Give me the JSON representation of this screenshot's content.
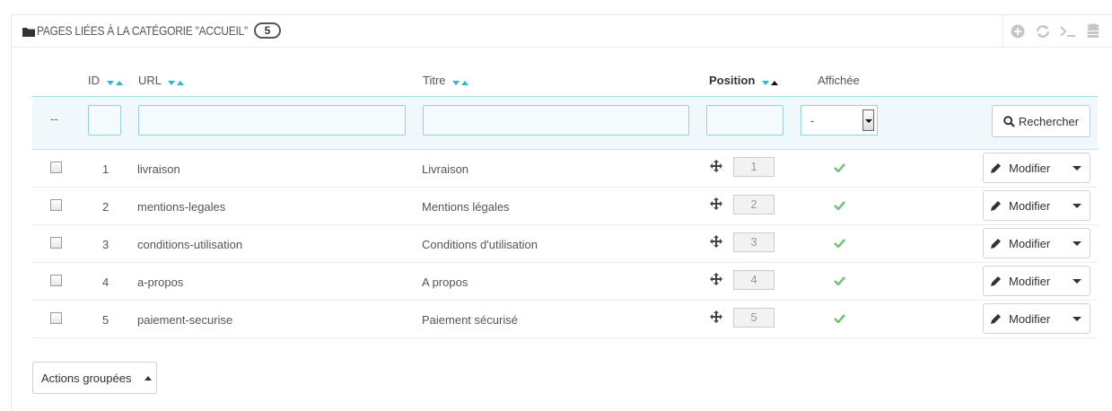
{
  "panel": {
    "title": "Pages liées à la catégorie \"Accueil\"",
    "count": "5",
    "toolbar": [
      "add-icon",
      "refresh-icon",
      "terminal-icon",
      "database-icon"
    ]
  },
  "table": {
    "headers": {
      "id": "ID",
      "url": "URL",
      "title": "Titre",
      "position": "Position",
      "displayed": "Affichée"
    },
    "filter": {
      "dash": "--",
      "displayed_value": "-",
      "search_label": "Rechercher"
    },
    "rows": [
      {
        "id": "1",
        "url": "livraison",
        "title": "Livraison",
        "position": "1",
        "displayed": true,
        "action": "Modifier"
      },
      {
        "id": "2",
        "url": "mentions-legales",
        "title": "Mentions légales",
        "position": "2",
        "displayed": true,
        "action": "Modifier"
      },
      {
        "id": "3",
        "url": "conditions-utilisation",
        "title": "Conditions d'utilisation",
        "position": "3",
        "displayed": true,
        "action": "Modifier"
      },
      {
        "id": "4",
        "url": "a-propos",
        "title": "A propos",
        "position": "4",
        "displayed": true,
        "action": "Modifier"
      },
      {
        "id": "5",
        "url": "paiement-securise",
        "title": "Paiement sécurisé",
        "position": "5",
        "displayed": true,
        "action": "Modifier"
      }
    ]
  },
  "bulk_actions_label": "Actions groupées",
  "colors": {
    "accent": "#25b9d7",
    "check": "#72c279",
    "filter_bg": "#f0f8fc"
  }
}
